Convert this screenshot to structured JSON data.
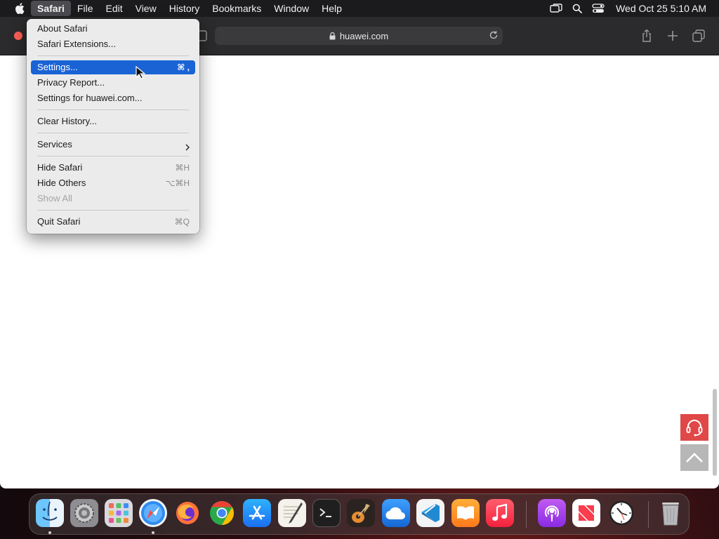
{
  "menubar": {
    "app_name": "Safari",
    "items": [
      "File",
      "Edit",
      "View",
      "History",
      "Bookmarks",
      "Window",
      "Help"
    ],
    "datetime": "Wed Oct 25  5:10 AM"
  },
  "toolbar": {
    "url": "huawei.com"
  },
  "app_menu": {
    "about": "About Safari",
    "extensions": "Safari Extensions...",
    "settings": "Settings...",
    "settings_shortcut": "⌘ ,",
    "privacy": "Privacy Report...",
    "settings_site": "Settings for huawei.com...",
    "clear_history": "Clear History...",
    "services": "Services",
    "hide": "Hide Safari",
    "hide_shortcut": "⌘H",
    "hide_others": "Hide Others",
    "hide_others_shortcut": "⌥⌘H",
    "show_all": "Show All",
    "quit": "Quit Safari",
    "quit_shortcut": "⌘Q"
  },
  "dock": {
    "apps": [
      "Finder",
      "System Settings",
      "Launchpad",
      "Safari",
      "Firefox",
      "Chrome",
      "App Store",
      "TextEdit",
      "Terminal",
      "GarageBand",
      "iCloud",
      "VS Code",
      "Books",
      "Music",
      "Podcasts",
      "News",
      "Clock",
      "Trash"
    ]
  },
  "colors": {
    "highlight": "#1a63d5",
    "support_button": "#e04848",
    "close_button": "#fe5f57"
  }
}
